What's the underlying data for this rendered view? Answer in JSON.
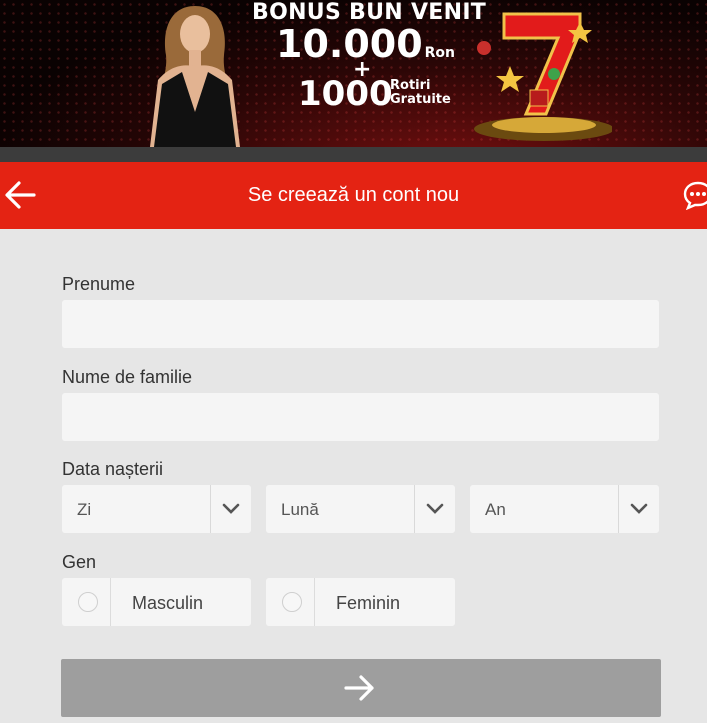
{
  "banner": {
    "line1": "BONUS BUN VENIT",
    "amount": "10.000",
    "currency": "Ron",
    "plus": "+",
    "spins": "1000",
    "spins_word1": "Rotiri",
    "spins_word2": "Gratuite"
  },
  "header": {
    "title": "Se creează un cont nou",
    "back_icon": "arrow-left-icon",
    "chat_icon": "chat-bubble-icon",
    "background": "#e42313"
  },
  "form": {
    "first_name_label": "Prenume",
    "first_name_value": "",
    "last_name_label": "Nume de familie",
    "last_name_value": "",
    "birth_label": "Data nașterii",
    "day": "Zi",
    "month": "Lună",
    "year": "An",
    "gender_label": "Gen",
    "gender_male": "Masculin",
    "gender_female": "Feminin",
    "submit_icon": "arrow-right-icon",
    "submit_color": "#9e9e9e"
  }
}
